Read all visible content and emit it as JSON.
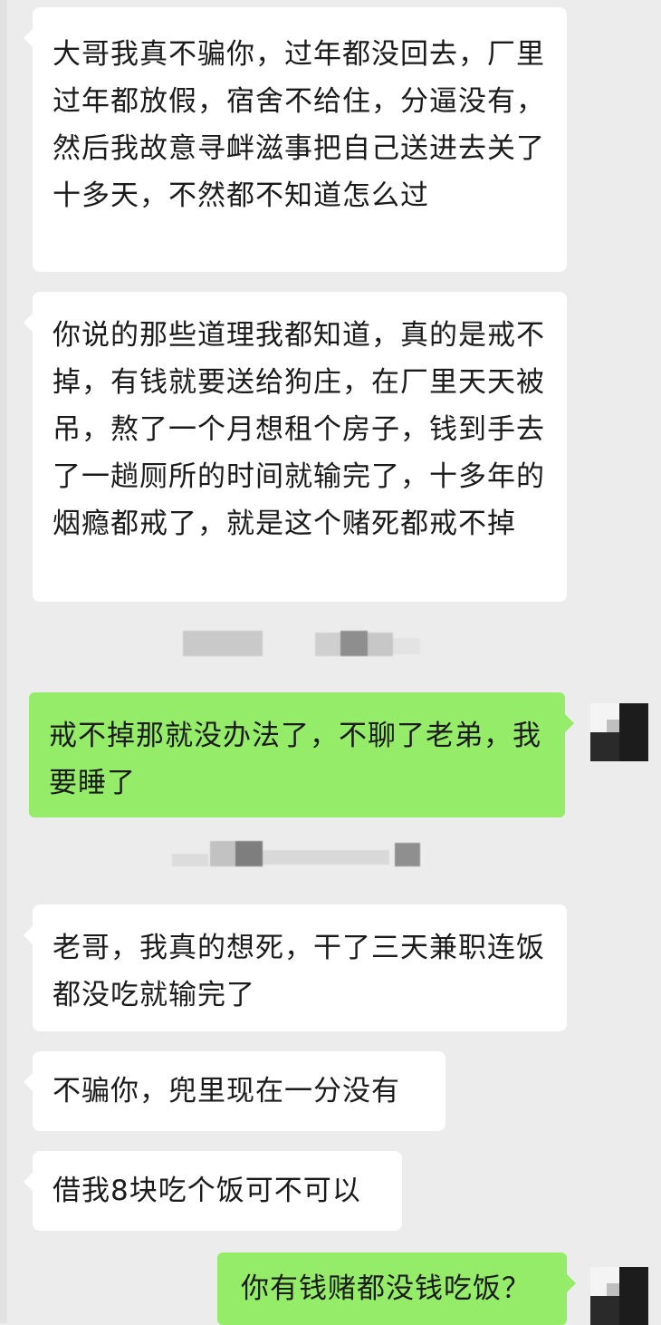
{
  "messages": [
    {
      "id": "m1",
      "side": "in",
      "text": "大哥我真不骗你，过年都没回去，厂里过年都放假，宿舍不给住，分逼没有，然后我故意寻衅滋事把自己送进去关了十多天，不然都不知道怎么过"
    },
    {
      "id": "m2",
      "side": "in",
      "text": "你说的那些道理我都知道，真的是戒不掉，有钱就要送给狗庄，在厂里天天被吊，熬了一个月想租个房子，钱到手去了一趟厕所的时间就输完了，十多年的烟瘾都戒了，就是这个赌死都戒不掉"
    },
    {
      "id": "m3",
      "side": "out",
      "text": "戒不掉那就没办法了，不聊了老弟，我要睡了"
    },
    {
      "id": "m4",
      "side": "in",
      "text": "老哥，我真的想死，干了三天兼职连饭都没吃就输完了"
    },
    {
      "id": "m5",
      "side": "in",
      "text": "不骗你，兜里现在一分没有"
    },
    {
      "id": "m6",
      "side": "in",
      "text": "借我8块吃个饭可不可以"
    },
    {
      "id": "m7",
      "side": "out",
      "text": "你有钱赌都没钱吃饭？"
    }
  ],
  "colors": {
    "background": "#ececec",
    "incoming_bubble": "#ffffff",
    "outgoing_bubble": "#95ec69"
  },
  "icons": {
    "self_avatar": "pixelated-avatar"
  }
}
